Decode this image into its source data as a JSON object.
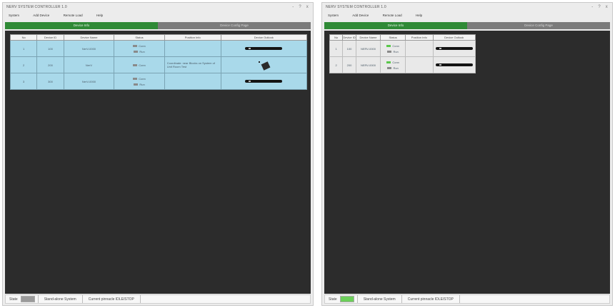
{
  "colors": {
    "tab_active": "#2f8a36",
    "tab_inactive": "#7b7b7b",
    "panel_bg": "#2c2c2c",
    "row_selected": "#a9d9ea",
    "row_normal": "#e9e9e9",
    "state_gray": "#9a9a9a",
    "state_green": "#6ccf5a",
    "status_green": "#5ac84b",
    "status_gray": "#8a8a8a"
  },
  "windows": [
    {
      "title": "NERV SYSTEM CONTROLLER 1.0",
      "controls": [
        "-",
        "?",
        "x"
      ],
      "menu": [
        "System",
        "Add Device",
        "Remote Load",
        "Help"
      ],
      "tabs": [
        "Device Info",
        "Device Config Page"
      ],
      "columns": [
        "No",
        "Device ID",
        "Device Name",
        "Status",
        "Position Info",
        "Device Outlook"
      ],
      "rows": [
        {
          "no": "1",
          "id": "100",
          "name": "NerV-0000",
          "status": [
            "Conn",
            "Run"
          ],
          "status_colors": [
            "status_gray",
            "status_gray"
          ],
          "position": "",
          "outlook": "bar"
        },
        {
          "no": "2",
          "id": "200",
          "name": "NerV",
          "status": [
            "Conn"
          ],
          "status_colors": [
            "status_gray"
          ],
          "position": "Coordinate: near Blocks on System of Unit Room Test",
          "outlook": "robot"
        },
        {
          "no": "3",
          "id": "300",
          "name": "NerV-0000",
          "status": [
            "Conn",
            "Run"
          ],
          "status_colors": [
            "status_gray",
            "status_gray"
          ],
          "position": "",
          "outlook": "bar"
        }
      ],
      "statusbar": {
        "state_label": "State",
        "state_color": "state_gray",
        "system": "Stand-alone System",
        "current": "Current pinnacle IDLE/STOP"
      }
    },
    {
      "title": "NERV SYSTEM CONTROLLER 1.0",
      "controls": [
        "-",
        "?",
        "x"
      ],
      "menu": [
        "System",
        "Add Device",
        "Remote Load",
        "Help"
      ],
      "tabs": [
        "Device Info",
        "Device Config Page"
      ],
      "columns": [
        "No",
        "Device ID",
        "Device Name",
        "Status",
        "Position Info",
        "Device Outlook"
      ],
      "rows": [
        {
          "no": "1",
          "id": "100",
          "name": "NERV-0000",
          "status": [
            "Conn",
            "Run"
          ],
          "status_colors": [
            "status_green",
            "status_gray"
          ],
          "position": "",
          "outlook": "bar"
        },
        {
          "no": "2",
          "id": "200",
          "name": "NERV-0000",
          "status": [
            "Conn",
            "Run"
          ],
          "status_colors": [
            "status_green",
            "status_gray"
          ],
          "position": "",
          "outlook": "bar"
        }
      ],
      "statusbar": {
        "state_label": "State",
        "state_color": "state_green",
        "system": "Stand-alone System",
        "current": "Current pinnacle IDLE/STOP"
      }
    }
  ]
}
